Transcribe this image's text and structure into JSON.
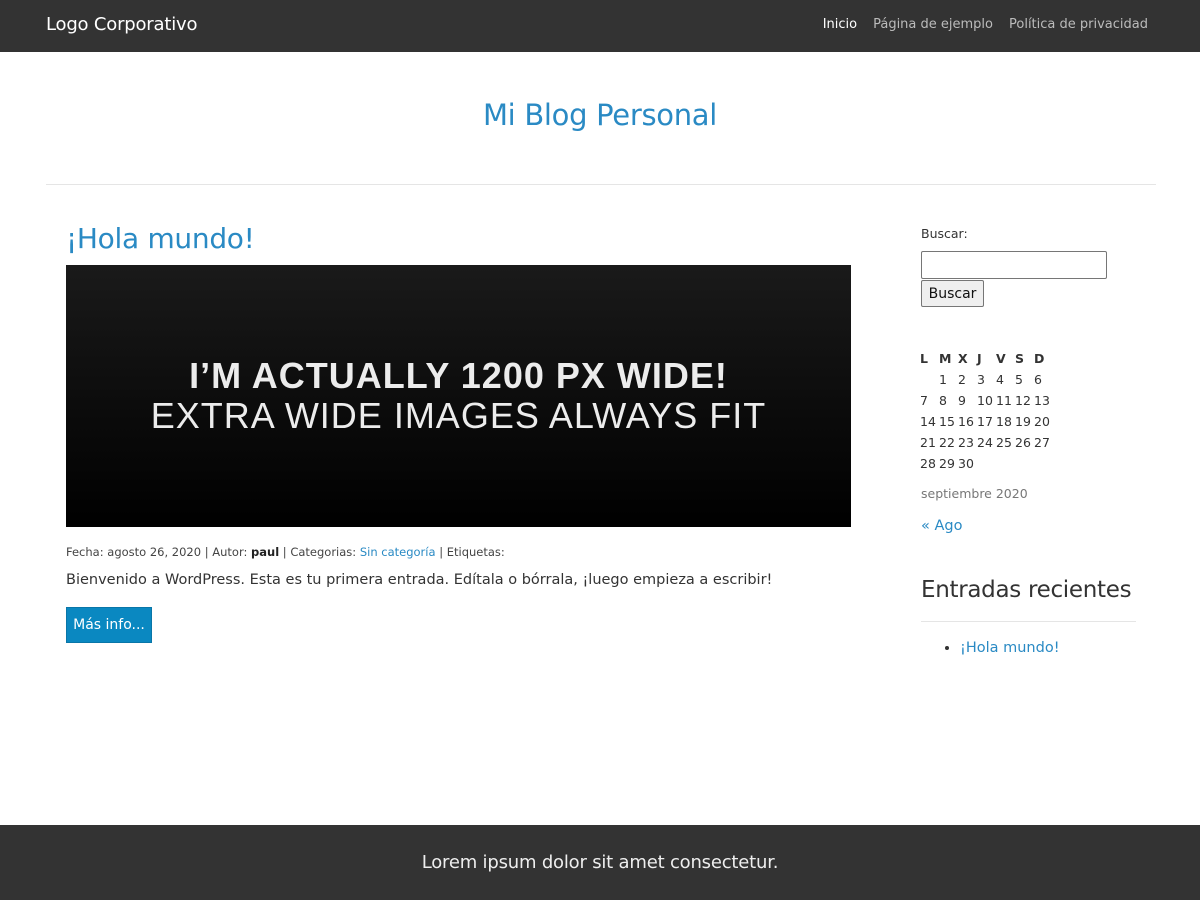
{
  "header": {
    "brand": "Logo Corporativo",
    "nav": [
      {
        "label": "Inicio",
        "active": true
      },
      {
        "label": "Página de ejemplo",
        "active": false
      },
      {
        "label": "Política de privacidad",
        "active": false
      }
    ]
  },
  "site_title": "Mi Blog Personal",
  "post": {
    "title": "¡Hola mundo!",
    "image_line1": "I’M ACTUALLY 1200 PX WIDE!",
    "image_line2": "EXTRA WIDE IMAGES ALWAYS FIT",
    "meta": {
      "date_label": "Fecha:",
      "date": "agosto 26, 2020",
      "author_label": "Autor:",
      "author": "paul",
      "categories_label": "Categorias:",
      "category": "Sin categoría",
      "tags_label": "Etiquetas:",
      "separator": "|"
    },
    "excerpt": "Bienvenido a WordPress. Esta es tu primera entrada. Edítala o bórrala, ¡luego empieza a escribir!",
    "more_button": "Más info..."
  },
  "sidebar": {
    "search": {
      "label": "Buscar:",
      "value": "",
      "button": "Buscar"
    },
    "calendar": {
      "days": [
        "L",
        "M",
        "X",
        "J",
        "V",
        "S",
        "D"
      ],
      "weeks": [
        [
          "",
          "1",
          "2",
          "3",
          "4",
          "5",
          "6"
        ],
        [
          "7",
          "8",
          "9",
          "10",
          "11",
          "12",
          "13"
        ],
        [
          "14",
          "15",
          "16",
          "17",
          "18",
          "19",
          "20"
        ],
        [
          "21",
          "22",
          "23",
          "24",
          "25",
          "26",
          "27"
        ],
        [
          "28",
          "29",
          "30",
          "",
          "",
          "",
          ""
        ]
      ],
      "caption": "septiembre 2020",
      "prev": "« Ago"
    },
    "recent": {
      "title": "Entradas recientes",
      "items": [
        "¡Hola mundo!"
      ]
    }
  },
  "footer": {
    "text": "Lorem ipsum dolor sit amet consectetur."
  },
  "colors": {
    "link": "#2a8ac4",
    "bar": "#333333",
    "button": "#0a88c1"
  }
}
